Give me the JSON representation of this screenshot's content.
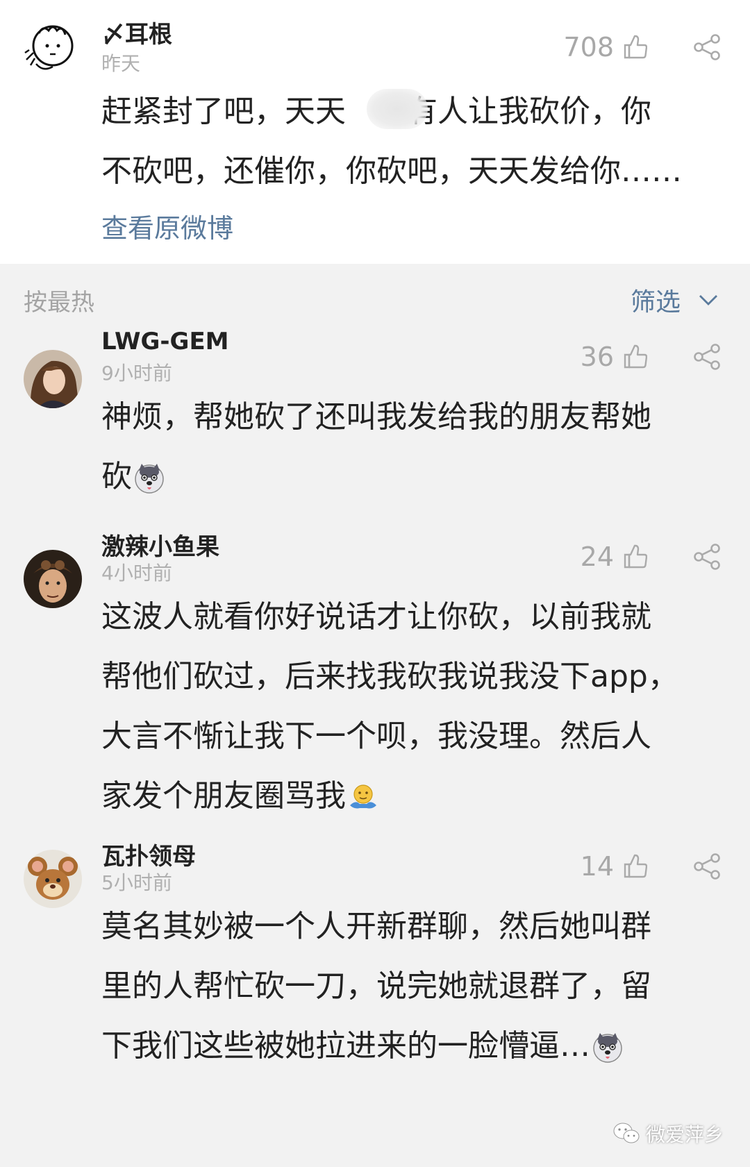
{
  "post": {
    "username": "〆耳根",
    "time": "昨天",
    "likes": "708",
    "text": "赶紧封了吧，天天都有有人让我砍价，你不砍吧，还催你，你砍吧，天天发给你……",
    "text_line1": "赶紧封了吧，天天",
    "text_line1b": "有人让我砍价，你",
    "text_line2": "不砍吧，还催你，你砍吧，天天发给你……",
    "view_original": "查看原微博",
    "avatar_icon": "cartoon-doodle-avatar"
  },
  "sortbar": {
    "sort_label": "按最热",
    "filter_label": "筛选",
    "filter_icon": "chevron-down-icon"
  },
  "comments": [
    {
      "username": "LWG-GEM",
      "time": "9小时前",
      "likes": "36",
      "line1": "神烦，帮她砍了还叫我发给我的朋友帮她",
      "line2": "砍",
      "emoji": "husky-emoji",
      "avatar_icon": "woman-portrait-avatar"
    },
    {
      "username": "激辣小鱼果",
      "time": "4小时前",
      "likes": "24",
      "line1": "这波人就看你好说话才让你砍，以前我就",
      "line2": "帮他们砍过，后来找我砍我说我没下app，",
      "line3": "大言不惭让我下一个呗，我没理。然后人",
      "line4": "家发个朋友圈骂我",
      "emoji": "shrug-emoji",
      "avatar_icon": "man-with-hat-avatar"
    },
    {
      "username": "瓦扑领母",
      "time": "5小时前",
      "likes": "14",
      "line1": "莫名其妙被一个人开新群聊，然后她叫群",
      "line2": "里的人帮忙砍一刀，说完她就退群了，留",
      "line3": "下我们这些被她拉进来的一脸懵逼…",
      "emoji": "husky-emoji",
      "avatar_icon": "cartoon-mouse-avatar"
    }
  ],
  "watermark": {
    "text": "微爱萍乡",
    "icon": "wechat-icon"
  },
  "colors": {
    "link": "#5a7a9c",
    "muted": "#b0b0b0",
    "background": "#f2f2f2"
  }
}
